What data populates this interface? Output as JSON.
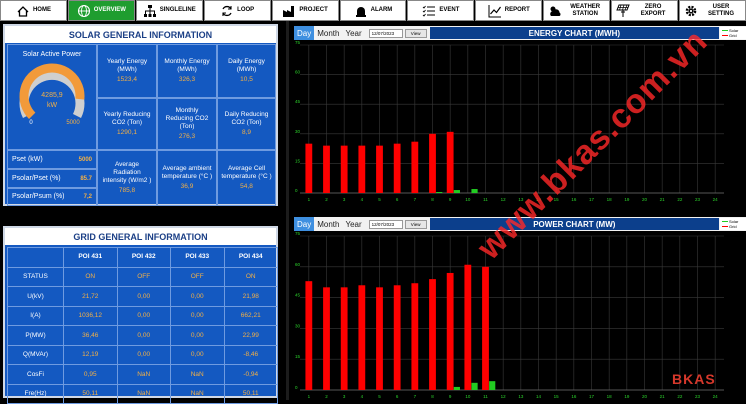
{
  "nav": [
    {
      "label": "HOME",
      "icon": "home-icon"
    },
    {
      "label": "OVERVIEW",
      "icon": "globe-icon"
    },
    {
      "label": "SINGLELINE",
      "icon": "network-icon"
    },
    {
      "label": "LOOP",
      "icon": "loop-icon"
    },
    {
      "label": "PROJECT",
      "icon": "factory-icon"
    },
    {
      "label": "ALARM",
      "icon": "alarm-icon"
    },
    {
      "label": "EVENT",
      "icon": "list-icon"
    },
    {
      "label": "REPORT",
      "icon": "report-icon"
    },
    {
      "label": "WEATHER STATION",
      "icon": "weather-icon"
    },
    {
      "label": "ZERO EXPORT",
      "icon": "solar-panel-icon"
    },
    {
      "label": "USER SETTING",
      "icon": "gear-icon"
    }
  ],
  "solar": {
    "title": "SOLAR GENERAL INFORMATION",
    "gauge_label": "Solar Active Power",
    "gauge_value": "4285,9",
    "gauge_unit": "kW",
    "gauge_min": "0",
    "gauge_max": "5000",
    "gauge_fraction": 0.857,
    "stats": [
      {
        "label": "Yearly Energy (MWh)",
        "value": "1523,4"
      },
      {
        "label": "Monthly Energy (MWh)",
        "value": "326,3"
      },
      {
        "label": "Daily Energy (MWh)",
        "value": "10,5"
      },
      {
        "label": "Yearly Reducing CO2 (Ton)",
        "value": "1290,1"
      },
      {
        "label": "Monthly Reducing CO2 (Ton)",
        "value": "276,3"
      },
      {
        "label": "Daily Reducing CO2 (Ton)",
        "value": "8,9"
      },
      {
        "label": "Average Radiation intensity (W/m2 )",
        "value": "785,8"
      },
      {
        "label": "Average ambient temperature (°C )",
        "value": "36,9"
      },
      {
        "label": "Average Cell temperature (°C )",
        "value": "54,8"
      }
    ],
    "psets": [
      {
        "label": "Pset (kW)",
        "value": "5000"
      },
      {
        "label": "Psolar/Pset (%)",
        "value": "85.7"
      },
      {
        "label": "Psolar/Psum (%)",
        "value": "7,2"
      }
    ]
  },
  "grid": {
    "title": "GRID GENERAL INFORMATION",
    "columns": [
      "POI 431",
      "POI 432",
      "POI 433",
      "POI 434"
    ],
    "rows": [
      {
        "label": "STATUS",
        "values": [
          "ON",
          "OFF",
          "OFF",
          "ON"
        ]
      },
      {
        "label": "U(kV)",
        "values": [
          "21,72",
          "0,00",
          "0,00",
          "21,98"
        ]
      },
      {
        "label": "I(A)",
        "values": [
          "1036,12",
          "0,00",
          "0,00",
          "662,21"
        ]
      },
      {
        "label": "P(MW)",
        "values": [
          "36,46",
          "0,00",
          "0,00",
          "22,99"
        ]
      },
      {
        "label": "Q(MVAr)",
        "values": [
          "12,19",
          "0,00",
          "0,00",
          "-8,46"
        ]
      },
      {
        "label": "CosFi",
        "values": [
          "0,95",
          "NaN",
          "NaN",
          "-0,94"
        ]
      },
      {
        "label": "Fre(Hz)",
        "values": [
          "50,11",
          "NaN",
          "NaN",
          "50,11"
        ]
      }
    ]
  },
  "energy_chart": {
    "tabs": [
      "Day",
      "Month",
      "Year"
    ],
    "date": "12/07/2023",
    "view_label": "View",
    "title": "ENERGY CHART (MWH)",
    "legend": [
      "Solar",
      "Grid"
    ]
  },
  "power_chart": {
    "tabs": [
      "Day",
      "Month",
      "Year"
    ],
    "date": "12/07/2023",
    "view_label": "View",
    "title": "POWER CHART (MW)",
    "legend": [
      "Solar",
      "Grid"
    ]
  },
  "chart_data": [
    {
      "type": "bar",
      "title": "ENERGY CHART (MWH)",
      "x": [
        1,
        2,
        3,
        4,
        5,
        6,
        7,
        8,
        9,
        10,
        11,
        12,
        13,
        14,
        15,
        16,
        17,
        18,
        19,
        20,
        21,
        22,
        23,
        24
      ],
      "ylim": [
        0,
        75
      ],
      "yticks": [
        0,
        15,
        30,
        45,
        60,
        75
      ],
      "series": [
        {
          "name": "Grid",
          "color": "#ff0000",
          "values": [
            25,
            24,
            24,
            24,
            24,
            25,
            26,
            30,
            31,
            0,
            0,
            0,
            0,
            0,
            0,
            0,
            0,
            0,
            0,
            0,
            0,
            0,
            0,
            0
          ]
        },
        {
          "name": "Solar",
          "color": "#22cc22",
          "values": [
            0,
            0,
            0,
            0,
            0,
            0,
            0,
            0.5,
            1.5,
            2,
            0,
            0,
            0,
            0,
            0,
            0,
            0,
            0,
            0,
            0,
            0,
            0,
            0,
            0
          ]
        }
      ]
    },
    {
      "type": "bar",
      "title": "POWER CHART (MW)",
      "x": [
        1,
        2,
        3,
        4,
        5,
        6,
        7,
        8,
        9,
        10,
        11,
        12,
        13,
        14,
        15,
        16,
        17,
        18,
        19,
        20,
        21,
        22,
        23,
        24
      ],
      "ylim": [
        0,
        75
      ],
      "yticks": [
        0,
        15,
        30,
        45,
        60,
        75
      ],
      "series": [
        {
          "name": "Grid",
          "color": "#ff0000",
          "values": [
            53,
            50,
            50,
            51,
            50,
            51,
            52,
            54,
            57,
            61,
            60,
            0,
            0,
            0,
            0,
            0,
            0,
            0,
            0,
            0,
            0,
            0,
            0,
            0
          ]
        },
        {
          "name": "Solar",
          "color": "#22cc22",
          "values": [
            0,
            0,
            0,
            0,
            0,
            0,
            0,
            0,
            1.5,
            3.5,
            4.3,
            0,
            0,
            0,
            0,
            0,
            0,
            0,
            0,
            0,
            0,
            0,
            0,
            0
          ]
        }
      ]
    }
  ],
  "watermark": "www.bkas.com.vn",
  "logo": "BKAS"
}
